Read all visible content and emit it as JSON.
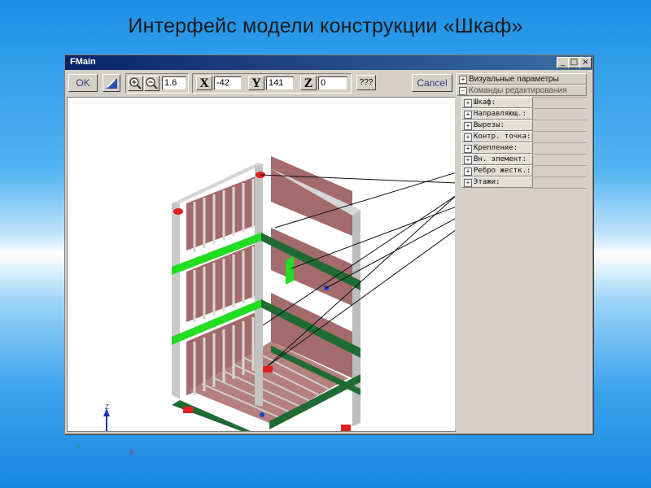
{
  "slide": {
    "title": "Интерфейс  модели конструкции «Шкаф»"
  },
  "window": {
    "title": "FMain",
    "controls": {
      "minimize": "_",
      "maximize": "□",
      "close": "×"
    }
  },
  "toolbar": {
    "ok_label": "OK",
    "zoom_value": "1.6",
    "x_label": "X",
    "x_value": "-42",
    "y_label": "Y",
    "y_value": "141",
    "z_label": "Z",
    "z_value": "0",
    "help_label": "???",
    "cancel_label": "Cancel"
  },
  "axes": {
    "z": "Z",
    "x": "X",
    "y": "Y"
  },
  "panel": {
    "sections": [
      {
        "label": "Визуальные параметры",
        "toggle": "+"
      },
      {
        "label": "Команды редактирования",
        "toggle": "−"
      }
    ],
    "items": [
      {
        "label": "Шкаф:",
        "toggle": "+"
      },
      {
        "label": "Направляющ.:",
        "toggle": "+"
      },
      {
        "label": "Вырезы:",
        "toggle": "+"
      },
      {
        "label": "Контр. точка:",
        "toggle": "+"
      },
      {
        "label": "Крепление:",
        "toggle": "+"
      },
      {
        "label": "Вн. элемент:",
        "toggle": "+"
      },
      {
        "label": "Ребро жестк.:",
        "toggle": "+"
      },
      {
        "label": "Этажи:",
        "toggle": "+"
      }
    ]
  },
  "colors": {
    "frame": "#c9c9c9",
    "back_panel": "#a36b6b",
    "shelf_dark": "#1f6b33",
    "shelf_light": "#22dd22",
    "fastener": "#e02020",
    "point": "#1d3fd0"
  }
}
